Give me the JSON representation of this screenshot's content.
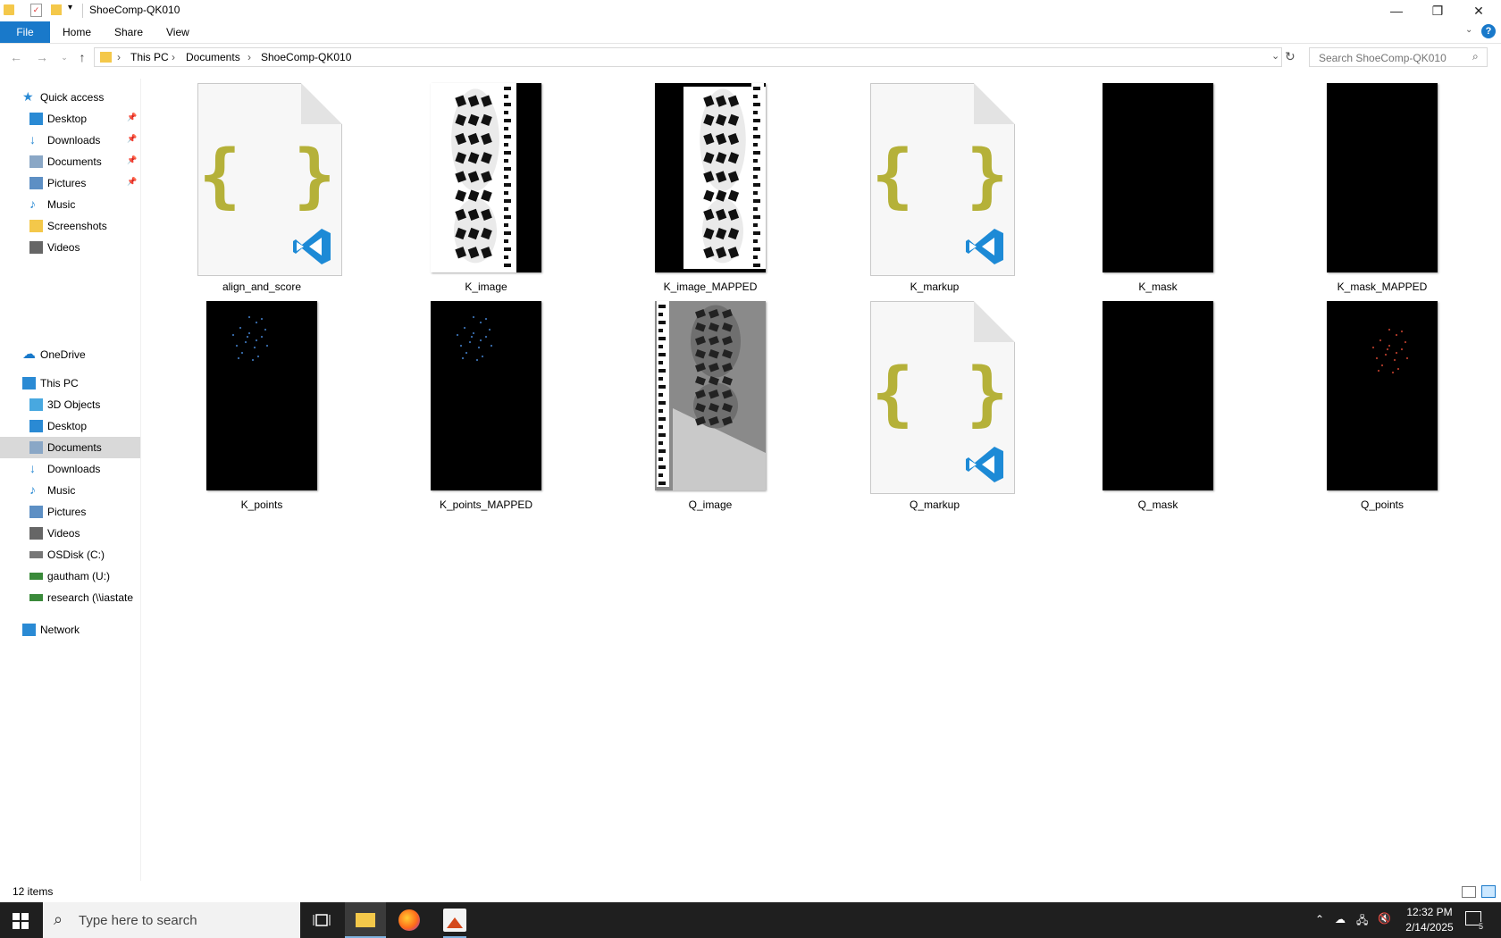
{
  "window": {
    "title": "ShoeComp-QK010",
    "minimize": "—",
    "restore": "❐",
    "close": "✕"
  },
  "ribbon": {
    "tabs": [
      "File",
      "Home",
      "Share",
      "View"
    ],
    "help": "?"
  },
  "address": {
    "crumbs": [
      "This PC",
      "Documents",
      "ShoeComp-QK010"
    ]
  },
  "search": {
    "placeholder": "Search ShoeComp-QK010"
  },
  "nav": {
    "quick_access": "Quick access",
    "quick_items": [
      {
        "label": "Desktop",
        "icon": "desktop-icon",
        "pinned": true
      },
      {
        "label": "Downloads",
        "icon": "downloads-icon",
        "pinned": true
      },
      {
        "label": "Documents",
        "icon": "documents-icon",
        "pinned": true
      },
      {
        "label": "Pictures",
        "icon": "pictures-icon",
        "pinned": true
      },
      {
        "label": "Music",
        "icon": "music-icon",
        "pinned": false
      },
      {
        "label": "Screenshots",
        "icon": "folder-icon",
        "pinned": false
      },
      {
        "label": "Videos",
        "icon": "videos-icon",
        "pinned": false
      }
    ],
    "onedrive": "OneDrive",
    "this_pc": "This PC",
    "pc_items": [
      {
        "label": "3D Objects",
        "icon": "3d-objects-icon"
      },
      {
        "label": "Desktop",
        "icon": "desktop-icon"
      },
      {
        "label": "Documents",
        "icon": "documents-icon"
      },
      {
        "label": "Downloads",
        "icon": "downloads-icon"
      },
      {
        "label": "Music",
        "icon": "music-icon"
      },
      {
        "label": "Pictures",
        "icon": "pictures-icon"
      },
      {
        "label": "Videos",
        "icon": "videos-icon"
      },
      {
        "label": "OSDisk (C:)",
        "icon": "drive-icon"
      },
      {
        "label": "gautham (U:)",
        "icon": "network-drive-icon"
      },
      {
        "label": "research (\\\\iastate.e",
        "icon": "network-drive-icon"
      }
    ],
    "network": "Network",
    "selected": "Documents"
  },
  "files": [
    {
      "name": "align_and_score",
      "kind": "json"
    },
    {
      "name": "K_image",
      "kind": "shoeprint"
    },
    {
      "name": "K_image_MAPPED",
      "kind": "shoeprint-mapped"
    },
    {
      "name": "K_markup",
      "kind": "json"
    },
    {
      "name": "K_mask",
      "kind": "black"
    },
    {
      "name": "K_mask_MAPPED",
      "kind": "black"
    },
    {
      "name": "K_points",
      "kind": "points-blue"
    },
    {
      "name": "K_points_MAPPED",
      "kind": "points-blue"
    },
    {
      "name": "Q_image",
      "kind": "shoeprint-gray"
    },
    {
      "name": "Q_markup",
      "kind": "json"
    },
    {
      "name": "Q_mask",
      "kind": "black"
    },
    {
      "name": "Q_points",
      "kind": "points-red"
    }
  ],
  "status": {
    "count": "12 items"
  },
  "taskbar": {
    "search_placeholder": "Type here to search",
    "time": "12:32 PM",
    "date": "2/14/2025",
    "notif_count": "5"
  }
}
